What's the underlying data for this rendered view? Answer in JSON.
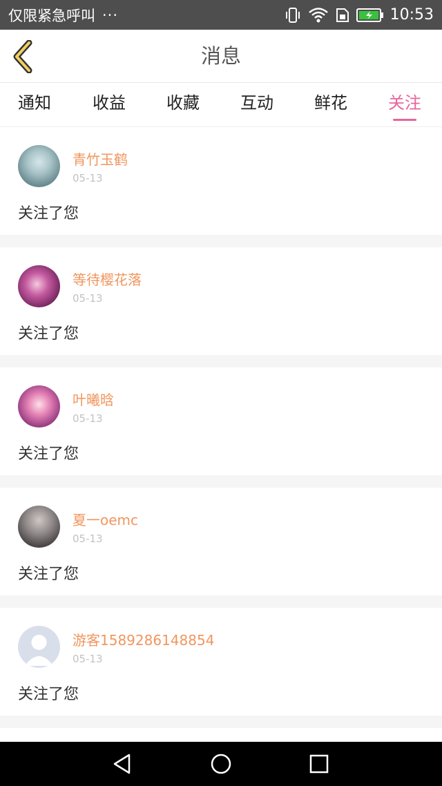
{
  "status_bar": {
    "carrier": "仅限紧急呼叫",
    "more": "···",
    "icons": [
      "vibrate-icon",
      "wifi-icon",
      "sim-icon",
      "battery-charging-icon"
    ],
    "time": "10:53"
  },
  "nav": {
    "back_icon": "chevron-left-icon",
    "title": "消息"
  },
  "tabs": [
    {
      "label": "通知",
      "active": false
    },
    {
      "label": "收益",
      "active": false
    },
    {
      "label": "收藏",
      "active": false
    },
    {
      "label": "互动",
      "active": false
    },
    {
      "label": "鲜花",
      "active": false
    },
    {
      "label": "关注",
      "active": true
    }
  ],
  "accent_color": "#e8649a",
  "name_color": "#f0965f",
  "notifications": [
    {
      "name": "青竹玉鹤",
      "date": "05-13",
      "message": "关注了您"
    },
    {
      "name": "等待樱花落",
      "date": "05-13",
      "message": "关注了您"
    },
    {
      "name": "叶曦晗",
      "date": "05-13",
      "message": "关注了您"
    },
    {
      "name": "夏一oemc",
      "date": "05-13",
      "message": "关注了您"
    },
    {
      "name": "游客1589286148854",
      "date": "05-13",
      "message": "关注了您"
    }
  ],
  "system_nav": [
    "back-triangle-icon",
    "home-circle-icon",
    "recents-square-icon"
  ]
}
